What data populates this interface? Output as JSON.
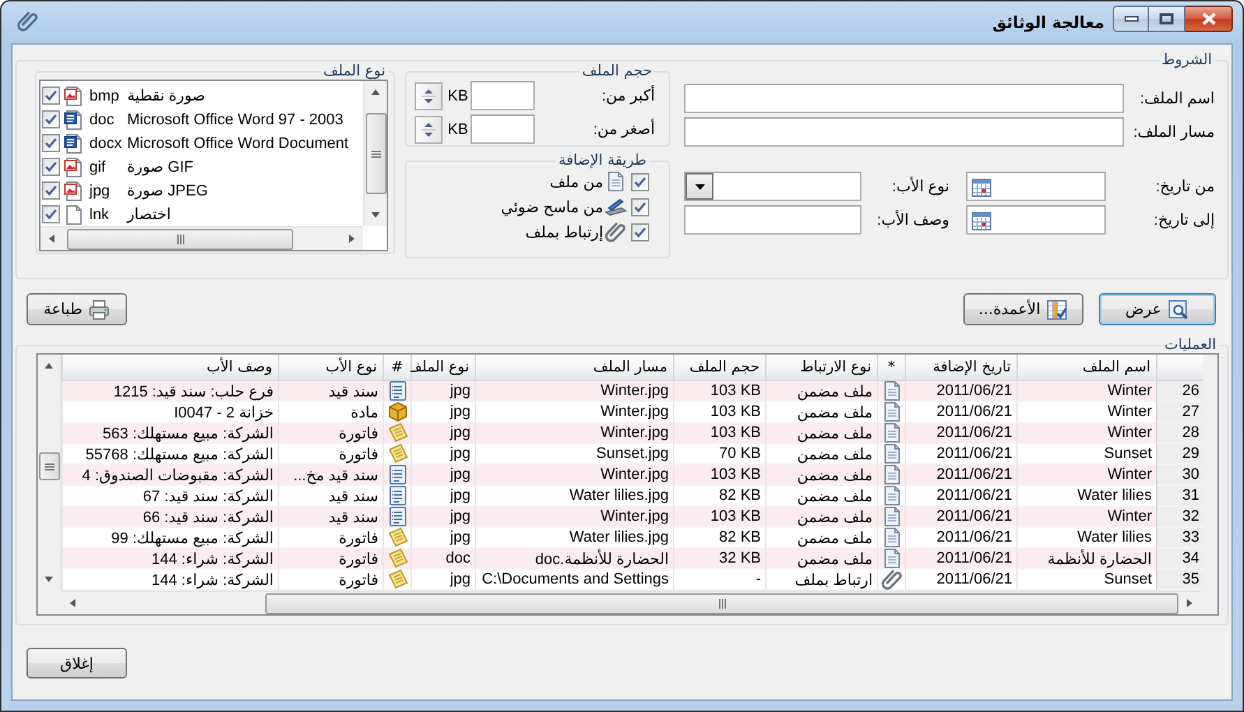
{
  "window": {
    "title": "معالجة الوثائق"
  },
  "conditions": {
    "title": "الشروط",
    "name_field": {
      "label": "اسم الملف:"
    },
    "path_field": {
      "label": "مسار الملف:"
    },
    "from_date": {
      "label": "من تاريخ:"
    },
    "to_date": {
      "label": "إلى تاريخ:"
    },
    "parent_type": {
      "label": "نوع الأب:"
    },
    "parent_desc": {
      "label": "وصف الأب:"
    },
    "file_size": {
      "title": "حجم الملف",
      "rows": [
        {
          "label": "أكبر من:",
          "unit": "KB"
        },
        {
          "label": "أصغر من:",
          "unit": "KB"
        }
      ]
    },
    "add_method": {
      "title": "طريقة الإضافة",
      "items": [
        {
          "kind": "file",
          "label": "من ملف",
          "checked": true
        },
        {
          "kind": "scanner",
          "label": "من ماسح ضوئي",
          "checked": true
        },
        {
          "kind": "link",
          "label": "إرتباط بملف",
          "checked": true
        }
      ]
    },
    "file_type": {
      "title": "نوع الملف",
      "items": [
        {
          "kind": "image",
          "ext": "bmp",
          "description": "صورة نقطية",
          "checked": true
        },
        {
          "kind": "word",
          "ext": "doc",
          "description": "Microsoft Office Word 97 - 2003",
          "checked": true
        },
        {
          "kind": "word",
          "ext": "docx",
          "description": "Microsoft Office Word Document",
          "checked": true
        },
        {
          "kind": "image",
          "ext": "gif",
          "description": "صورة GIF",
          "checked": true
        },
        {
          "kind": "image",
          "ext": "jpg",
          "description": "صورة JPEG",
          "checked": true
        },
        {
          "kind": "blank",
          "ext": "lnk",
          "description": "اختصار",
          "checked": true
        }
      ]
    }
  },
  "toolbar": {
    "view_button": {
      "label": "عرض",
      "default": true
    },
    "columns_button": {
      "label": "الأعمدة...",
      "default": false
    },
    "print_button": {
      "label": "طباعة",
      "default": false
    }
  },
  "operations": {
    "title": "العمليات",
    "columns": [
      "اسم الملف",
      "تاريخ الإضافة",
      "*",
      "نوع الارتباط",
      "حجم الملف",
      "مسار الملف",
      "نوع الملف",
      "#",
      "نوع الأب",
      "وصف الأب"
    ],
    "rows": [
      {
        "number": "26",
        "name": "Winter",
        "date": "2011/06/21",
        "link": {
          "kind": "embedded",
          "type": "ملف مضمن"
        },
        "size": "103 KB",
        "path": "Winter.jpg",
        "file_type": "jpg",
        "parent": {
          "kind": "journal",
          "type": "سند قيد"
        },
        "parent_desc": "فرع حلب: سند قيد: 1215"
      },
      {
        "number": "27",
        "name": "Winter",
        "date": "2011/06/21",
        "link": {
          "kind": "embedded",
          "type": "ملف مضمن"
        },
        "size": "103 KB",
        "path": "Winter.jpg",
        "file_type": "jpg",
        "parent": {
          "kind": "item",
          "type": "مادة"
        },
        "parent_desc": "I0047 - خزانة 2"
      },
      {
        "number": "28",
        "name": "Winter",
        "date": "2011/06/21",
        "link": {
          "kind": "embedded",
          "type": "ملف مضمن"
        },
        "size": "103 KB",
        "path": "Winter.jpg",
        "file_type": "jpg",
        "parent": {
          "kind": "invoice",
          "type": "فاتورة"
        },
        "parent_desc": "الشركة: مبيع مستهلك: 563"
      },
      {
        "number": "29",
        "name": "Sunset",
        "date": "2011/06/21",
        "link": {
          "kind": "embedded",
          "type": "ملف مضمن"
        },
        "size": "70 KB",
        "path": "Sunset.jpg",
        "file_type": "jpg",
        "parent": {
          "kind": "invoice",
          "type": "فاتورة"
        },
        "parent_desc": "الشركة: مبيع مستهلك: 55768"
      },
      {
        "number": "30",
        "name": "Winter",
        "date": "2011/06/21",
        "link": {
          "kind": "embedded",
          "type": "ملف مضمن"
        },
        "size": "103 KB",
        "path": "Winter.jpg",
        "file_type": "jpg",
        "parent": {
          "kind": "journal",
          "type": "سند قيد مخ..."
        },
        "parent_desc": "الشركة: مقبوضات الصندوق: 4"
      },
      {
        "number": "31",
        "name": "Water lilies",
        "date": "2011/06/21",
        "link": {
          "kind": "embedded",
          "type": "ملف مضمن"
        },
        "size": "82 KB",
        "path": "Water lilies.jpg",
        "file_type": "jpg",
        "parent": {
          "kind": "journal",
          "type": "سند قيد"
        },
        "parent_desc": "الشركة: سند قيد: 67"
      },
      {
        "number": "32",
        "name": "Winter",
        "date": "2011/06/21",
        "link": {
          "kind": "embedded",
          "type": "ملف مضمن"
        },
        "size": "103 KB",
        "path": "Winter.jpg",
        "file_type": "jpg",
        "parent": {
          "kind": "journal",
          "type": "سند قيد"
        },
        "parent_desc": "الشركة: سند قيد: 66"
      },
      {
        "number": "33",
        "name": "Water lilies",
        "date": "2011/06/21",
        "link": {
          "kind": "embedded",
          "type": "ملف مضمن"
        },
        "size": "82 KB",
        "path": "Water lilies.jpg",
        "file_type": "jpg",
        "parent": {
          "kind": "invoice",
          "type": "فاتورة"
        },
        "parent_desc": "الشركة: مبيع مستهلك: 99"
      },
      {
        "number": "34",
        "name": "الحضارة  للأنظمة",
        "date": "2011/06/21",
        "link": {
          "kind": "embedded",
          "type": "ملف مضمن"
        },
        "size": "32 KB",
        "path": "الحضارة  للأنظمة.doc",
        "file_type": "doc",
        "parent": {
          "kind": "invoice",
          "type": "فاتورة"
        },
        "parent_desc": "الشركة: شراء: 144"
      },
      {
        "number": "35",
        "name": "Sunset",
        "date": "2011/06/21",
        "link": {
          "kind": "link",
          "type": "ارتباط بملف"
        },
        "size": "-",
        "path": "C:\\Documents and Settings",
        "file_type": "jpg",
        "parent": {
          "kind": "invoice",
          "type": "فاتورة"
        },
        "parent_desc": "الشركة: شراء: 144"
      }
    ]
  },
  "close_button": {
    "label": "إغلاق"
  }
}
